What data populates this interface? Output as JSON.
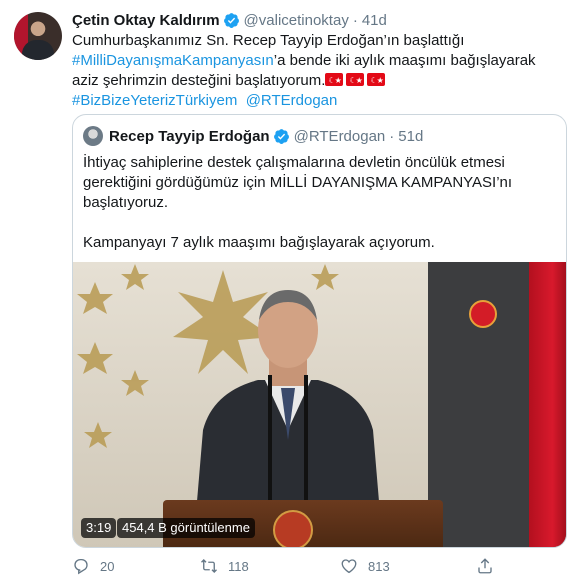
{
  "author": {
    "name": "Çetin Oktay Kaldırım",
    "handle": "@valicetinoktay",
    "separator": "·",
    "time": "41d"
  },
  "tweet": {
    "text_1": "Cumhurbaşkanımız Sn. Recep Tayyip Erdoğan’ın başlattığı",
    "hashtag_1": "#MilliDayanışmaKampanyasın",
    "text_2": "’a bende iki aylık maaşımı bağışlayarak aziz şehrimzin desteğini başlatıyorum.",
    "hashtag_2": "#BizBizeYeterizTürkiyem",
    "mention": "@RTErdogan"
  },
  "quoted": {
    "name": "Recep Tayyip Erdoğan",
    "handle": "@RTErdogan",
    "separator": "·",
    "time": "51d",
    "paragraph_1": "İhtiyaç sahiplerine destek çalışmalarına devletin öncülük etmesi gerektiğini gördüğümüz için MİLLİ DAYANIŞMA KAMPANYASI’nı başlatıyoruz.",
    "paragraph_2": "Kampanyayı 7 aylık maaşımı bağışlayarak açıyorum.",
    "video": {
      "duration": "3:19",
      "views": "454,4 B görüntülenme"
    }
  },
  "actions": {
    "reply_count": "20",
    "retweet_count": "118",
    "like_count": "813"
  },
  "icons": {
    "verified": "verified-badge-icon",
    "reply": "reply-icon",
    "retweet": "retweet-icon",
    "like": "heart-icon",
    "share": "share-icon",
    "flag": "turkey-flag-emoji"
  },
  "colors": {
    "link": "#1b95e0",
    "text": "#14171a",
    "muted": "#657786",
    "border": "#ccd6dd"
  }
}
